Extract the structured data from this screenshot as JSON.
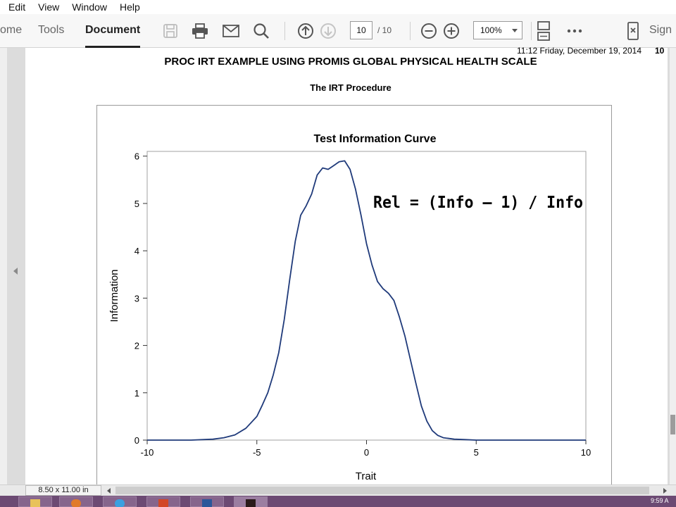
{
  "menu": [
    "Edit",
    "View",
    "Window",
    "Help"
  ],
  "toolbar": {
    "tabs": [
      "ome",
      "Tools",
      "Document"
    ],
    "page_number": "10",
    "page_total": "/ 10",
    "zoom": "100%",
    "sign_label": "Sign"
  },
  "icons": {
    "save": "save-icon",
    "print": "print-icon",
    "email": "mail-icon",
    "search": "search-icon",
    "prev": "arrow-up-circle-icon",
    "next": "arrow-down-circle-icon",
    "zoom_out": "minus-circle-icon",
    "zoom_in": "plus-circle-icon",
    "fit": "fit-page-icon",
    "more": "more-icon",
    "sign": "fill-sign-icon"
  },
  "document": {
    "header_stamp": "11:12 Friday, December 19, 2014",
    "header_page": "10",
    "title": "PROC IRT EXAMPLE USING PROMIS GLOBAL PHYSICAL HEALTH SCALE",
    "subtitle": "The IRT Procedure",
    "annotation": "Rel = (Info – 1) / Info"
  },
  "chart_data": {
    "type": "line",
    "title": "Test Information Curve",
    "xlabel": "Trait",
    "ylabel": "Information",
    "xlim": [
      -10,
      10
    ],
    "ylim": [
      0,
      6.1
    ],
    "xticks": [
      -10,
      -5,
      0,
      5,
      10
    ],
    "yticks": [
      0,
      1,
      2,
      3,
      4,
      5,
      6
    ],
    "grid": false,
    "line_color": "#1f3a7a",
    "x": [
      -10,
      -8,
      -7,
      -6.5,
      -6,
      -5.5,
      -5,
      -4.75,
      -4.5,
      -4.25,
      -4,
      -3.75,
      -3.5,
      -3.25,
      -3,
      -2.75,
      -2.5,
      -2.25,
      -2,
      -1.75,
      -1.5,
      -1.25,
      -1,
      -0.75,
      -0.5,
      -0.25,
      0,
      0.25,
      0.5,
      0.75,
      1,
      1.25,
      1.5,
      1.75,
      2,
      2.25,
      2.5,
      2.75,
      3,
      3.25,
      3.5,
      4,
      4.5,
      5,
      6,
      8,
      10
    ],
    "y": [
      0,
      0,
      0.02,
      0.05,
      0.11,
      0.25,
      0.5,
      0.74,
      1.0,
      1.38,
      1.85,
      2.55,
      3.4,
      4.2,
      4.75,
      4.95,
      5.2,
      5.6,
      5.75,
      5.72,
      5.8,
      5.88,
      5.9,
      5.72,
      5.3,
      4.75,
      4.15,
      3.7,
      3.35,
      3.2,
      3.1,
      2.95,
      2.6,
      2.2,
      1.7,
      1.2,
      0.72,
      0.4,
      0.2,
      0.1,
      0.05,
      0.02,
      0.01,
      0.0,
      0.0,
      0,
      0
    ]
  },
  "status": {
    "page_size": "8.50 x 11.00 in"
  },
  "taskbar": {
    "clock": "9:59 A"
  }
}
